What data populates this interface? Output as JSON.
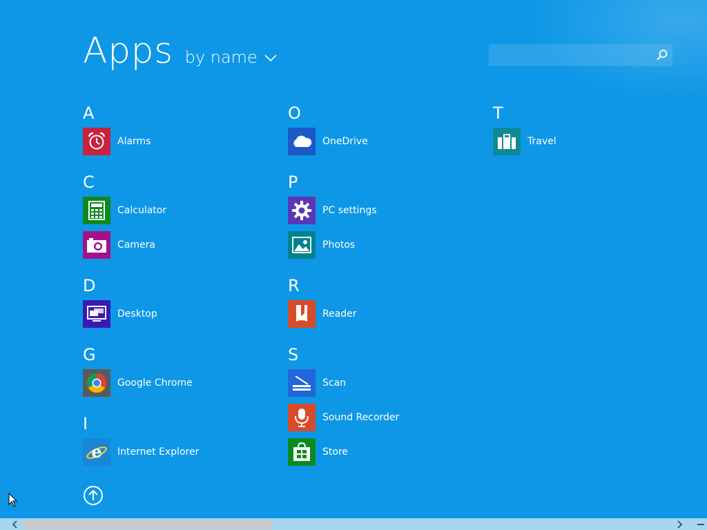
{
  "header": {
    "title": "Apps",
    "sort_label": "by name"
  },
  "search": {
    "placeholder": "",
    "value": ""
  },
  "columns": [
    {
      "groups": [
        {
          "letter": "A",
          "apps": [
            {
              "label": "Alarms",
              "icon": "alarm-clock-icon",
              "color": "#c8223c"
            }
          ]
        },
        {
          "letter": "C",
          "apps": [
            {
              "label": "Calculator",
              "icon": "calculator-icon",
              "color": "#0a8a1f"
            },
            {
              "label": "Camera",
              "icon": "camera-icon",
              "color": "#a3128a"
            }
          ]
        },
        {
          "letter": "D",
          "apps": [
            {
              "label": "Desktop",
              "icon": "desktop-icon",
              "color": "#3b1ab2"
            }
          ]
        },
        {
          "letter": "G",
          "apps": [
            {
              "label": "Google Chrome",
              "icon": "chrome-icon",
              "color": "#5a5a5a"
            }
          ]
        },
        {
          "letter": "I",
          "apps": [
            {
              "label": "Internet Explorer",
              "icon": "internet-explorer-icon",
              "color": "#1a86d6"
            }
          ]
        }
      ]
    },
    {
      "groups": [
        {
          "letter": "O",
          "apps": [
            {
              "label": "OneDrive",
              "icon": "cloud-icon",
              "color": "#1a59c6"
            }
          ]
        },
        {
          "letter": "P",
          "apps": [
            {
              "label": "PC settings",
              "icon": "gear-icon",
              "color": "#5b37b4"
            },
            {
              "label": "Photos",
              "icon": "photo-icon",
              "color": "#00838f"
            }
          ]
        },
        {
          "letter": "R",
          "apps": [
            {
              "label": "Reader",
              "icon": "reader-icon",
              "color": "#d84b2a"
            }
          ]
        },
        {
          "letter": "S",
          "apps": [
            {
              "label": "Scan",
              "icon": "scanner-icon",
              "color": "#2266d8"
            },
            {
              "label": "Sound Recorder",
              "icon": "microphone-icon",
              "color": "#d84b2a"
            },
            {
              "label": "Store",
              "icon": "store-icon",
              "color": "#0a8a1f"
            }
          ]
        }
      ]
    },
    {
      "groups": [
        {
          "letter": "T",
          "apps": [
            {
              "label": "Travel",
              "icon": "suitcase-icon",
              "color": "#0f8a94"
            }
          ]
        }
      ]
    }
  ],
  "colors": {
    "background": "#0d97e6",
    "scrollbar_track": "#a5d6ef",
    "scrollbar_thumb": "#c9c9c9"
  }
}
